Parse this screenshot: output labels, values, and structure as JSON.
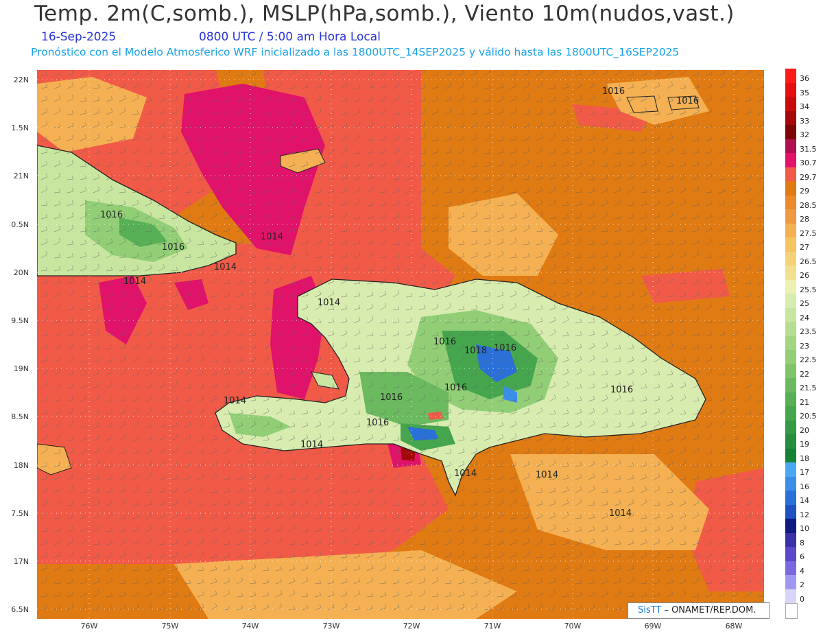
{
  "header": {
    "title": "Temp. 2m(C,somb.), MSLP(hPa,somb.), Viento 10m(nudos,vast.)",
    "date": "16-Sep-2025",
    "valid_time": "0800 UTC / 5:00 am Hora Local",
    "forecast_note": "Pronóstico con el Modelo Atmosferico WRF inicializado a las 1800UTC_14SEP2025 y válido hasta las  1800UTC_16SEP2025"
  },
  "axes": {
    "lat_labels": [
      "22N",
      "1.5N",
      "21N",
      "0.5N",
      "20N",
      "9.5N",
      "19N",
      "8.5N",
      "18N",
      "7.5N",
      "17N",
      "6.5N"
    ],
    "lon_labels": [
      "76W",
      "75W",
      "74W",
      "73W",
      "72W",
      "71W",
      "70W",
      "69W",
      "68W"
    ]
  },
  "isobars": [
    {
      "label": "1016"
    },
    {
      "label": "1016"
    },
    {
      "label": "1016"
    },
    {
      "label": "1016"
    },
    {
      "label": "1014"
    },
    {
      "label": "1014"
    },
    {
      "label": "1014"
    },
    {
      "label": "1014"
    },
    {
      "label": "1016"
    },
    {
      "label": "1018"
    },
    {
      "label": "1016"
    },
    {
      "label": "1016"
    },
    {
      "label": "1016"
    },
    {
      "label": "1016"
    },
    {
      "label": "1016"
    },
    {
      "label": "1014"
    },
    {
      "label": "1014"
    },
    {
      "label": "1014"
    },
    {
      "label": "1014"
    },
    {
      "label": "1014"
    }
  ],
  "colorbar": [
    {
      "label": "36",
      "color": "#ff1a1a"
    },
    {
      "label": "35",
      "color": "#e60f0f"
    },
    {
      "label": "34",
      "color": "#c80c0c"
    },
    {
      "label": "33",
      "color": "#a50808"
    },
    {
      "label": "32",
      "color": "#7d0505"
    },
    {
      "label": "31.5",
      "color": "#b01050"
    },
    {
      "label": "30.7",
      "color": "#e0126a"
    },
    {
      "label": "29.7",
      "color": "#f25a48"
    },
    {
      "label": "29",
      "color": "#e07a12"
    },
    {
      "label": "28.5",
      "color": "#ea8a28"
    },
    {
      "label": "28",
      "color": "#ef9a42"
    },
    {
      "label": "27.5",
      "color": "#f4b052"
    },
    {
      "label": "27",
      "color": "#f7c462"
    },
    {
      "label": "26.5",
      "color": "#f5d27a"
    },
    {
      "label": "26",
      "color": "#f0e090"
    },
    {
      "label": "25.5",
      "color": "#ecf0b0"
    },
    {
      "label": "25",
      "color": "#d8ecb0"
    },
    {
      "label": "24",
      "color": "#c8e6a0"
    },
    {
      "label": "23.5",
      "color": "#b6de90"
    },
    {
      "label": "23",
      "color": "#a4d682"
    },
    {
      "label": "22.5",
      "color": "#92ce76"
    },
    {
      "label": "22",
      "color": "#80c46a"
    },
    {
      "label": "21.5",
      "color": "#6cba60"
    },
    {
      "label": "21",
      "color": "#58b056"
    },
    {
      "label": "20.5",
      "color": "#46a64e"
    },
    {
      "label": "20",
      "color": "#349a46"
    },
    {
      "label": "19",
      "color": "#248e3e"
    },
    {
      "label": "18",
      "color": "#168236"
    },
    {
      "label": "17",
      "color": "#4aa8f0"
    },
    {
      "label": "16",
      "color": "#3a8ee8"
    },
    {
      "label": "14",
      "color": "#2a70d8"
    },
    {
      "label": "12",
      "color": "#1e52c0"
    },
    {
      "label": "10",
      "color": "#101a80"
    },
    {
      "label": "8",
      "color": "#3a30a8"
    },
    {
      "label": "6",
      "color": "#5a48c8"
    },
    {
      "label": "4",
      "color": "#7a68e0"
    },
    {
      "label": "2",
      "color": "#a098f0"
    },
    {
      "label": "0",
      "color": "#d8d4f8"
    },
    {
      "label": "",
      "color": "#ffffff"
    }
  ],
  "credit": {
    "brand": "SisTT",
    "text": "– ONAMET/REP.DOM."
  }
}
